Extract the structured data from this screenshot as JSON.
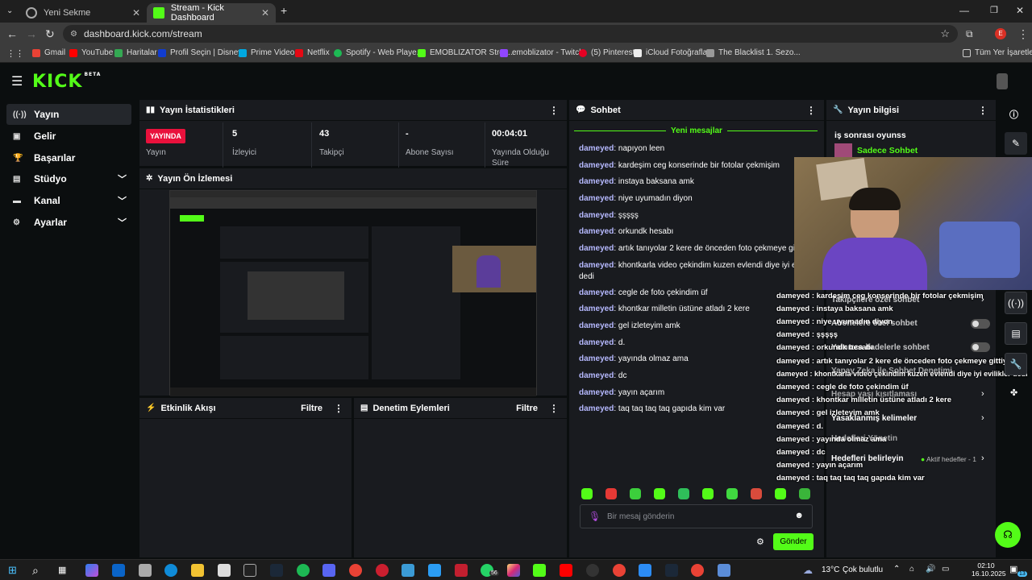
{
  "browser": {
    "tabs": [
      {
        "title": "Yeni Sekme",
        "active": false
      },
      {
        "title": "Stream - Kick Dashboard",
        "active": true
      }
    ],
    "url": "dashboard.kick.com/stream",
    "profile_initial": "E",
    "bookmarks": [
      "Gmail",
      "YouTube",
      "Haritalar",
      "Profil Seçin | Disney+",
      "Prime Video",
      "Netflix",
      "Spotify - Web Playe...",
      "EMOBLIZATOR Strea...",
      "emoblizator - Twitch",
      "(5) Pinterest",
      "iCloud Fotoğrafları",
      "The Blacklist 1. Sezo...",
      "Tüm Yer İşaretleri"
    ]
  },
  "kick": {
    "logo": "KICK",
    "logo_tag": "BETA",
    "sidebar": [
      {
        "label": "Yayın",
        "icon": "broadcast-icon",
        "active": true,
        "expandable": false
      },
      {
        "label": "Gelir",
        "icon": "revenue-icon",
        "active": false,
        "expandable": false
      },
      {
        "label": "Başarılar",
        "icon": "trophy-icon",
        "active": false,
        "expandable": false
      },
      {
        "label": "Stüdyo",
        "icon": "studio-icon",
        "active": false,
        "expandable": true
      },
      {
        "label": "Kanal",
        "icon": "channel-icon",
        "active": false,
        "expandable": true
      },
      {
        "label": "Ayarlar",
        "icon": "settings-icon",
        "active": false,
        "expandable": true
      }
    ],
    "stats": {
      "title": "Yayın İstatistikleri",
      "items": [
        {
          "value": "YAYINDA",
          "label": "Yayın"
        },
        {
          "value": "5",
          "label": "İzleyici"
        },
        {
          "value": "43",
          "label": "Takipçi"
        },
        {
          "value": "-",
          "label": "Abone Sayısı"
        },
        {
          "value": "00:04:01",
          "label": "Yayında Olduğu Süre"
        }
      ]
    },
    "preview_title": "Yayın Ön İzlemesi",
    "activity": {
      "title": "Etkinlik Akışı",
      "filter": "Filtre"
    },
    "moderation": {
      "title": "Denetim Eylemleri",
      "filter": "Filtre"
    },
    "chat": {
      "title": "Sohbet",
      "new_messages": "Yeni mesajlar",
      "messages": [
        {
          "user": "dameyed",
          "text": "napıyon leen"
        },
        {
          "user": "dameyed",
          "text": "kardeşim ceg konserinde bir fotolar çekmişim"
        },
        {
          "user": "dameyed",
          "text": "instaya baksana amk"
        },
        {
          "user": "dameyed",
          "text": "niye uyumadın diyon"
        },
        {
          "user": "dameyed",
          "text": "şşşşş"
        },
        {
          "user": "dameyed",
          "text": "orkundk hesabı"
        },
        {
          "user": "dameyed",
          "text": "artık tanıyolar 2 kere de önceden foto çekmeye gittiydim"
        },
        {
          "user": "dameyed",
          "text": "khontkarla video çekindim kuzen evlendi diye iyi evilik"
        },
        {
          "user": "",
          "text": "dedi"
        },
        {
          "user": "dameyed",
          "text": "cegle de foto çekindim üf"
        },
        {
          "user": "dameyed",
          "text": "khontkar milletin üstüne atladı 2 kere"
        },
        {
          "user": "dameyed",
          "text": "gel izleteyim amk"
        },
        {
          "user": "dameyed",
          "text": "d."
        },
        {
          "user": "dameyed",
          "text": "yayında olmaz ama"
        },
        {
          "user": "dameyed",
          "text": "dc"
        },
        {
          "user": "dameyed",
          "text": "yayın açarım"
        },
        {
          "user": "dameyed",
          "text": "taq taq taq taq gapıda kim var"
        }
      ],
      "input_placeholder": "Bir mesaj gönderin",
      "send": "Gönder"
    },
    "overlay_chat": [
      "dameyed : kardeşim ceg konserinde bir fotolar çekmişim",
      "dameyed : instaya baksana amk",
      "dameyed : niye uyumadın diyon",
      "dameyed : şşşşş",
      "dameyed : orkundk hesabı",
      "dameyed : artık tanıyolar 2 kere de önceden foto çekmeye gittiydim",
      "dameyed : khontkarla video çekindim kuzen evlendi diye iyi evilikler dedi",
      "dameyed : cegle de foto çekindim üf",
      "dameyed : khontkar milletin üstüne atladı 2 kere",
      "dameyed : gel izleteyim amk",
      "dameyed : d.",
      "dameyed : yayında olmaz ama",
      "dameyed : dc",
      "dameyed : yayın açarım",
      "dameyed : taq taq taq taq gapıda kim var"
    ],
    "info": {
      "title": "Yayın bilgisi",
      "stream_title": "iş sonrası oyunss",
      "category": "Sadece Sohbet",
      "settings": [
        "Takipçilere özel sohbet",
        "Abonelere özel sohbet",
        "Yalnızca ifadelerle sohbet",
        "Yapay Zeka ile Sohbet Denetimi",
        "Hesap yaşı kısıtlaması",
        "Yasaklanmış kelimeler",
        "Hedefleri Yönetin",
        "Hedefleri belirleyin"
      ],
      "goals_active": "Aktif hedefler - 1"
    }
  },
  "taskbar": {
    "weather_temp": "13°C",
    "weather_text": "Çok bulutlu",
    "time": "02:10",
    "date": "16.10.2025",
    "whatsapp_badge": "56",
    "notif_count": "13"
  },
  "colors": {
    "kick_green": "#53fc18",
    "live_red": "#e9113c",
    "panel": "#191b1f"
  }
}
